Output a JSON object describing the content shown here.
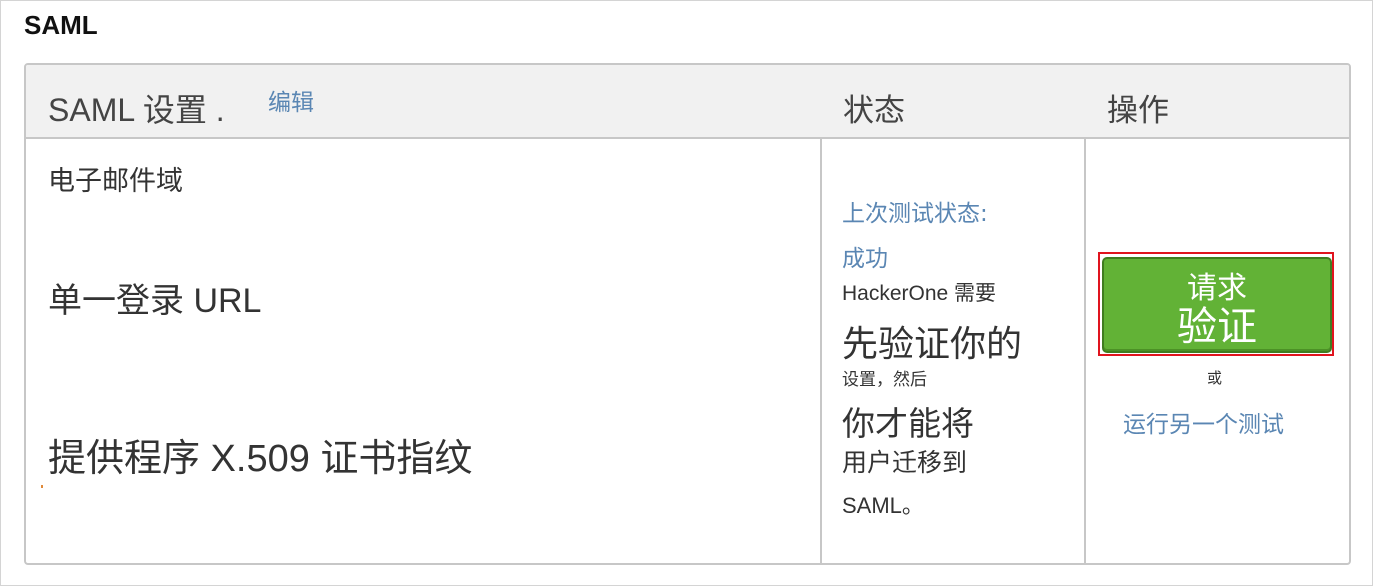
{
  "section": {
    "title": "SAML"
  },
  "table": {
    "header": {
      "settings_label": "SAML 设置 .",
      "edit_link": "编辑",
      "status_label": "状态",
      "action_label": "操作"
    },
    "fields": {
      "email_domain": "电子邮件域",
      "sso_url": "单一登录 URL",
      "cert_fingerprint": "提供程序 X.509 证书指纹"
    },
    "status": {
      "last_test_label": "上次测试状态:",
      "last_test_value": "成功",
      "message_lines": [
        "HackerOne 需要",
        "先验证你的",
        "设置，然后",
        "你才能将",
        "用户迁移到",
        "SAML。"
      ]
    },
    "action": {
      "verify_button_line1": "请求",
      "verify_button_line2": "验证",
      "or_text": "或",
      "run_another_test": "运行另一个测试"
    }
  },
  "colors": {
    "link": "#5a86b3",
    "button_green": "#62b236",
    "highlight_red": "#e0141e",
    "header_bg": "#f1f1f1",
    "border": "#c7c7c7"
  }
}
